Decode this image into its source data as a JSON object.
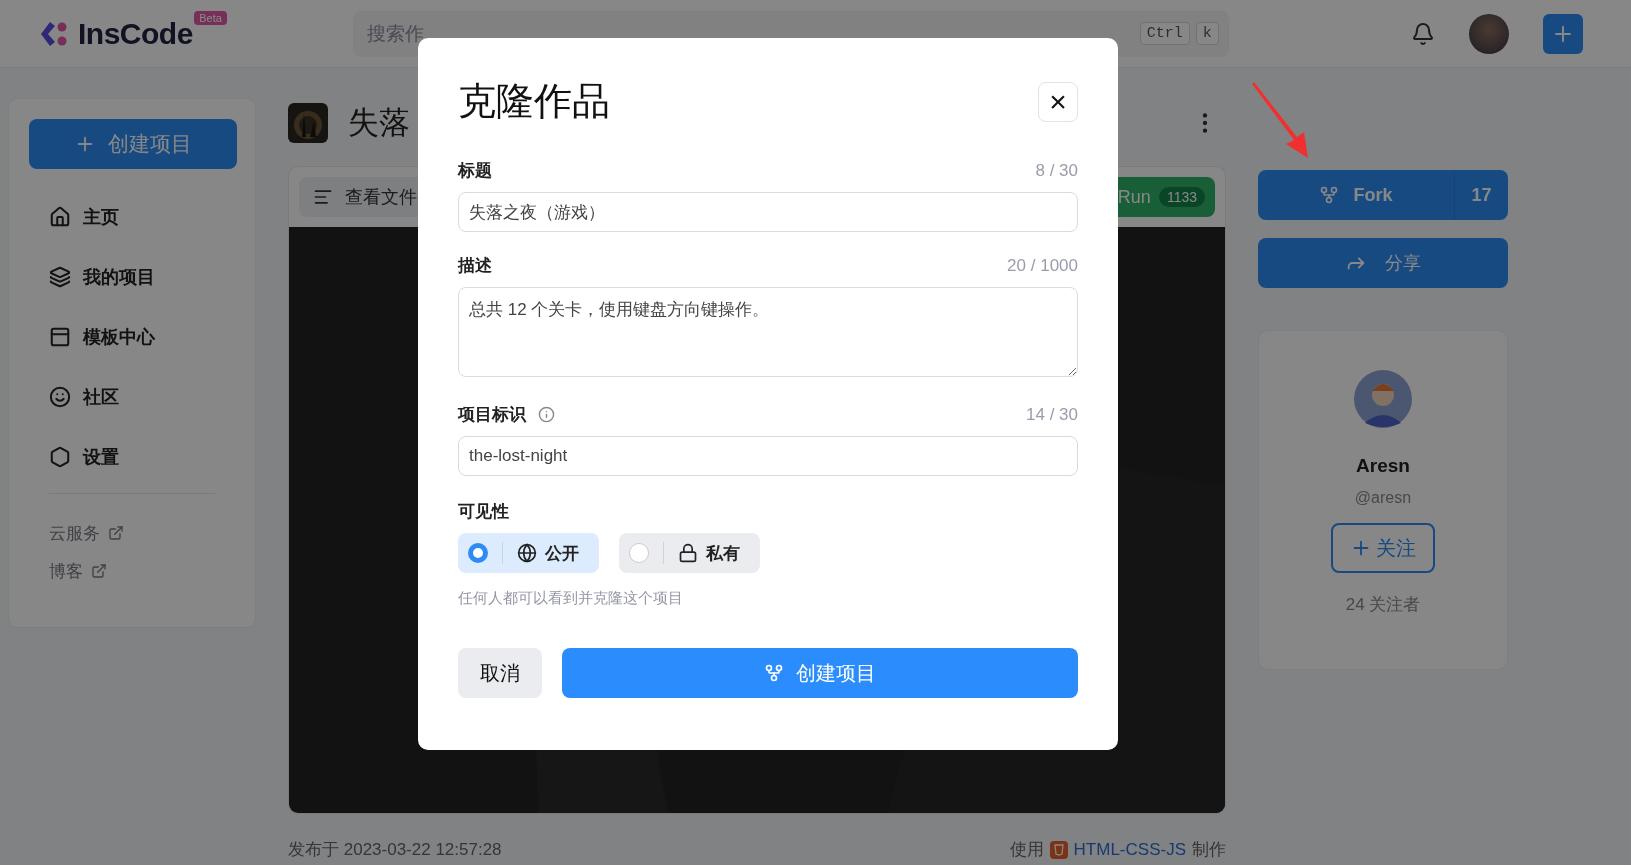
{
  "header": {
    "logo": "InsCode",
    "badge": "Beta",
    "search": {
      "placeholder": "搜索作"
    },
    "shortcut": [
      "Ctrl",
      "k"
    ]
  },
  "sidebar": {
    "create_button": "创建项目",
    "items": [
      {
        "label": "主页"
      },
      {
        "label": "我的项目"
      },
      {
        "label": "模板中心"
      },
      {
        "label": "社区"
      },
      {
        "label": "设置"
      }
    ],
    "links": [
      {
        "label": "云服务"
      },
      {
        "label": "博客"
      }
    ]
  },
  "project": {
    "title": "失落",
    "toolbar": {
      "files_button": "查看文件",
      "run": {
        "label": "Run",
        "count": "1133"
      }
    },
    "footer": {
      "published": "发布于 2023-03-22 12:57:28",
      "made_with": {
        "prefix": "使用",
        "tech": "HTML-CSS-JS",
        "suffix": "制作"
      }
    }
  },
  "actions": {
    "fork": {
      "label": "Fork",
      "count": "17"
    },
    "share": "分享"
  },
  "author": {
    "name": "Aresn",
    "handle": "@aresn",
    "follow": "关注",
    "followers": "24 关注者"
  },
  "dialog": {
    "title": "克隆作品",
    "close": "×",
    "fields": [
      {
        "kind": "input",
        "label": "标题",
        "info": false,
        "counter": "8 / 30",
        "value": "失落之夜（游戏）"
      },
      {
        "kind": "textarea",
        "label": "描述",
        "info": false,
        "counter": "20 / 1000",
        "value": "总共 12 个关卡，使用键盘方向键操作。"
      },
      {
        "kind": "input",
        "label": "项目标识",
        "info": true,
        "counter": "14 / 30",
        "value": "the-lost-night"
      }
    ],
    "visibility": {
      "label": "可见性",
      "options": [
        {
          "label": "公开",
          "selected": true
        },
        {
          "label": "私有",
          "selected": false
        }
      ],
      "hint": "任何人都可以看到并克隆这个项目"
    },
    "cancel": "取消",
    "submit": "创建项目"
  }
}
